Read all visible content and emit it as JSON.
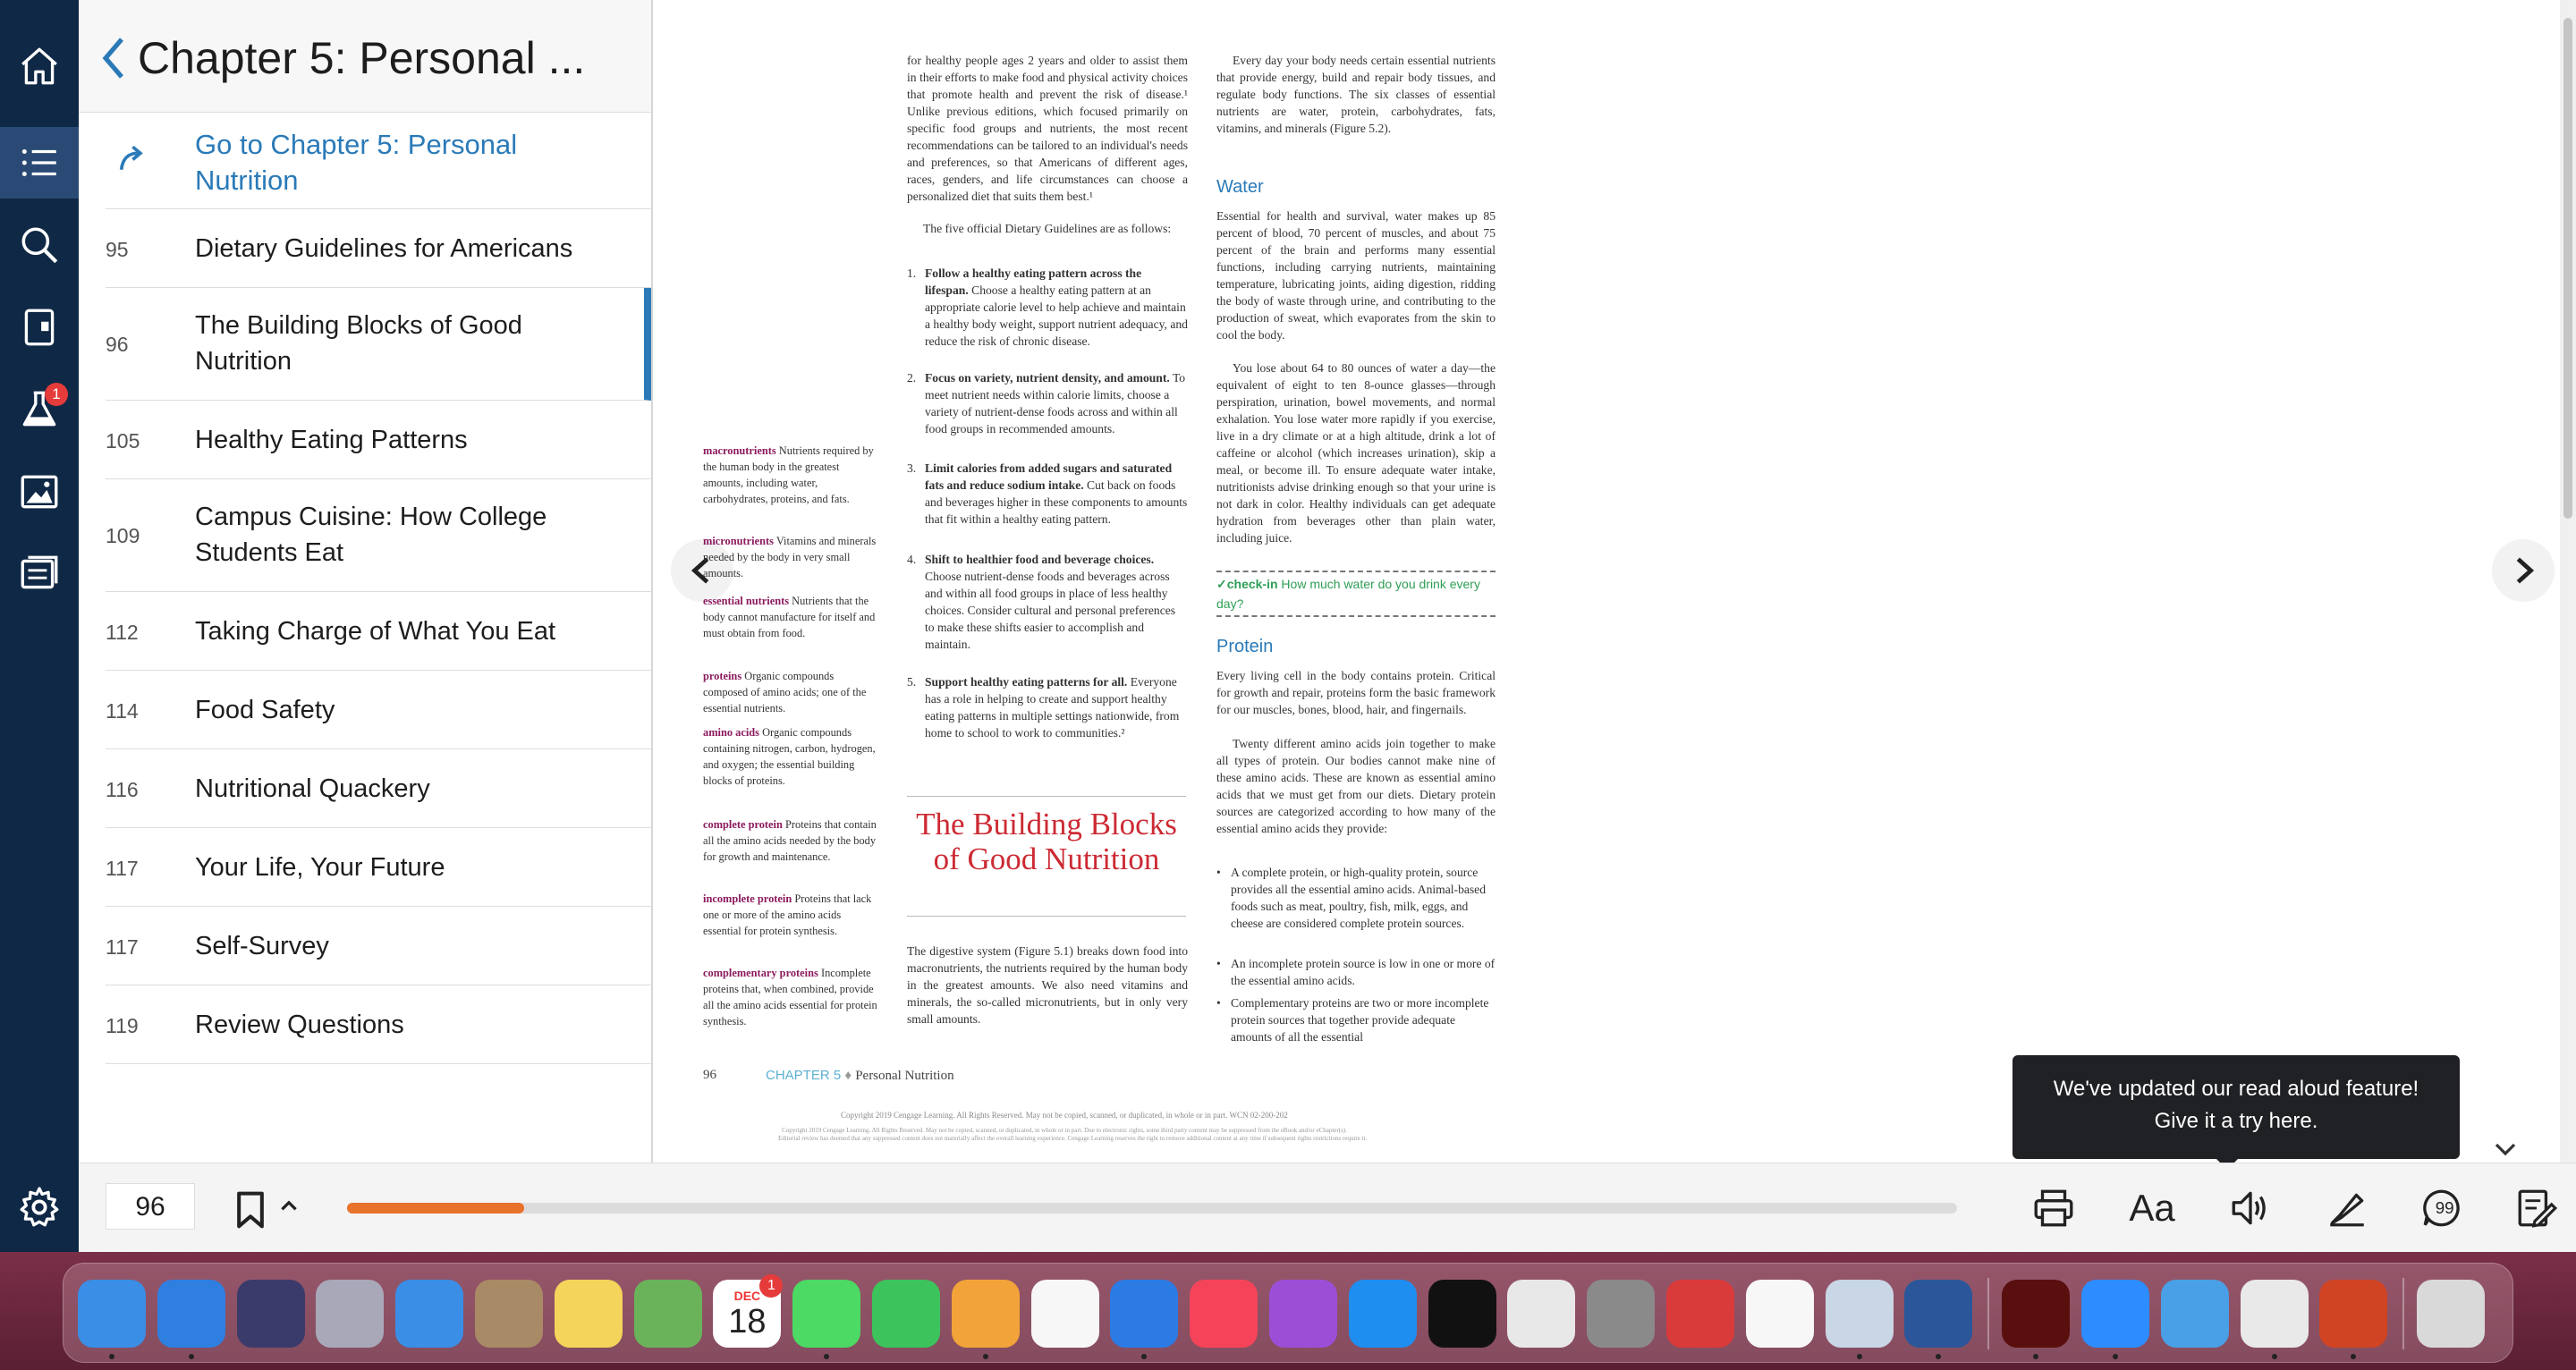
{
  "sidebar_rail": {
    "items": [
      {
        "icon": "home-icon"
      },
      {
        "icon": "table-of-contents-icon",
        "active": true
      },
      {
        "icon": "search-icon"
      },
      {
        "icon": "notebook-icon"
      },
      {
        "icon": "flask-icon",
        "badge": "1"
      },
      {
        "icon": "image-icon"
      },
      {
        "icon": "notes-icon"
      }
    ],
    "settings_icon": "gear-icon"
  },
  "toc": {
    "title": "Chapter 5: Personal ...",
    "goto_label": "Go to Chapter 5: Personal Nutrition",
    "items": [
      {
        "page": "95",
        "label": "Dietary Guidelines for Americans"
      },
      {
        "page": "96",
        "label": "The Building Blocks of Good Nutrition",
        "current": true
      },
      {
        "page": "105",
        "label": "Healthy Eating Patterns"
      },
      {
        "page": "109",
        "label": "Campus Cuisine: How College Students Eat"
      },
      {
        "page": "112",
        "label": "Taking Charge of What You Eat"
      },
      {
        "page": "114",
        "label": "Food Safety"
      },
      {
        "page": "116",
        "label": "Nutritional Quackery"
      },
      {
        "page": "117",
        "label": "Your Life, Your Future"
      },
      {
        "page": "117",
        "label": "Self-Survey"
      },
      {
        "page": "119",
        "label": "Review Questions"
      }
    ]
  },
  "book_page": {
    "glossary": [
      {
        "term": "macronutrients",
        "def": "Nutrients required by the human body in the greatest amounts, including water, carbohydrates, proteins, and fats."
      },
      {
        "term": "micronutrients",
        "def": "Vitamins and minerals needed by the body in very small amounts."
      },
      {
        "term": "essential nutrients",
        "def": "Nutrients that the body cannot manufacture for itself and must obtain from food."
      },
      {
        "term": "proteins",
        "def": "Organic compounds composed of amino acids; one of the essential nutrients."
      },
      {
        "term": "amino acids",
        "def": "Organic compounds containing nitrogen, carbon, hydrogen, and oxygen; the essential building blocks of proteins."
      },
      {
        "term": "complete protein",
        "def": "Proteins that contain all the amino acids needed by the body for growth and maintenance."
      },
      {
        "term": "incomplete protein",
        "def": "Proteins that lack one or more of the amino acids essential for protein synthesis."
      },
      {
        "term": "complementary proteins",
        "def": "Incomplete proteins that, when combined, provide all the amino acids essential for protein synthesis."
      }
    ],
    "col2_intro": "for healthy people ages 2 years and older to assist them in their efforts to make food and physical activity choices that promote health and prevent the risk of disease.¹ Unlike previous editions, which focused primarily on specific food groups and nutrients, the most recent recommendations can be tailored to an individual's needs and preferences, so that Americans of different ages, races, genders, and life circumstances can choose a personalized diet that suits them best.¹",
    "col2_intro2": "The five official Dietary Guidelines are as follows:",
    "guidelines": [
      {
        "num": "1.",
        "bold": "Follow a healthy eating pattern across the lifespan.",
        "text": " Choose a healthy eating pattern at an appropriate calorie level to help achieve and maintain a healthy body weight, support nutrient adequacy, and reduce the risk of chronic disease."
      },
      {
        "num": "2.",
        "bold": "Focus on variety, nutrient density, and amount.",
        "text": " To meet nutrient needs within calorie limits, choose a variety of nutrient-dense foods across and within all food groups in recommended amounts."
      },
      {
        "num": "3.",
        "bold": "Limit calories from added sugars and saturated fats and reduce sodium intake.",
        "text": " Cut back on foods and beverages higher in these components to amounts that fit within a healthy eating pattern."
      },
      {
        "num": "4.",
        "bold": "Shift to healthier food and beverage choices.",
        "text": " Choose nutrient-dense foods and beverages across and within all food groups in place of less healthy choices. Consider cultural and personal preferences to make these shifts easier to accomplish and maintain."
      },
      {
        "num": "5.",
        "bold": "Support healthy eating patterns for all.",
        "text": " Everyone has a role in helping to create and support healthy eating patterns in multiple settings nationwide, from home to school to work to communities.²"
      }
    ],
    "section_title": "The Building Blocks of Good Nutrition",
    "section_text": "The digestive system (Figure 5.1) breaks down food into macronutrients, the nutrients required by the human body in the greatest amounts. We also need vitamins and minerals, the so-called micronutrients, but in only very small amounts.",
    "col3_intro": "Every day your body needs certain essential nutrients that provide energy, build and repair body tissues, and regulate body functions. The six classes of essential nutrients are water, protein, carbohydrates, fats, vitamins, and minerals (Figure 5.2).",
    "water_heading": "Water",
    "water_p1": "Essential for health and survival, water makes up 85 percent of blood, 70 percent of muscles, and about 75 percent of the brain and performs many essential functions, including carrying nutrients, maintaining temperature, lubricating joints, aiding digestion, ridding the body of waste through urine, and contributing to the production of sweat, which evaporates from the skin to cool the body.",
    "water_p2": "You lose about 64 to 80 ounces of water a day—the equivalent of eight to ten 8-ounce glasses—through perspiration, urination, bowel movements, and normal exhalation. You lose water more rapidly if you exercise, live in a dry climate or at a high altitude, drink a lot of caffeine or alcohol (which increases urination), skip a meal, or become ill. To ensure adequate water intake, nutritionists advise drinking enough so that your urine is not dark in color. Healthy individuals can get adequate hydration from beverages other than plain water, including juice.",
    "checkin_label": "✓check-in",
    "checkin_text": "How much water do you drink every day?",
    "protein_heading": "Protein",
    "protein_p1": "Every living cell in the body contains protein. Critical for growth and repair, proteins form the basic framework for our muscles, bones, blood, hair, and fingernails.",
    "protein_p2": "Twenty different amino acids join together to make all types of protein. Our bodies cannot make nine of these amino acids. These are known as essential amino acids that we must get from our diets. Dietary protein sources are categorized according to how many of the essential amino acids they provide:",
    "protein_bullets": [
      "A complete protein, or high-quality protein, source provides all the essential amino acids. Animal-based foods such as meat, poultry, fish, milk, eggs, and cheese are considered complete protein sources.",
      "An incomplete protein source is low in one or more of the essential amino acids.",
      "Complementary proteins are two or more incomplete protein sources that together provide adequate amounts of all the essential"
    ],
    "footer_page": "96",
    "footer_chapter": "CHAPTER 5",
    "footer_chapter_sep": "♦",
    "footer_chapter_title": "Personal Nutrition",
    "copyright1": "Copyright 2019 Cengage Learning. All Rights Reserved. May not be copied, scanned, or duplicated, in whole or in part.  WCN 02-200-202",
    "copyright2": "Copyright 2019 Cengage Learning. All Rights Reserved. May not be copied, scanned, or duplicated, in whole or in part. Due to electronic rights, some third party content may be suppressed from the eBook and/or eChapter(s).",
    "copyright3": "Editorial review has deemed that any suppressed content does not materially affect the overall learning experience. Cengage Learning reserves the right to remove additional content at any time if subsequent rights restrictions require it."
  },
  "tooltip": {
    "line1": "We've updated our read aloud feature!",
    "line2": "Give it a try here."
  },
  "toolbar": {
    "page_value": "96",
    "progress_fraction": 0.11,
    "aa_label": "Aa",
    "icons": [
      "printer-icon",
      "font-size-icon",
      "read-aloud-speaker-icon",
      "highlighter-icon",
      "comment-icon",
      "notes-edit-icon"
    ]
  },
  "dock": {
    "calendar_month": "DEC",
    "calendar_day": "18",
    "calendar_badge": "1",
    "apps": [
      {
        "name": "finder",
        "color": "#3a8ee6"
      },
      {
        "name": "safari",
        "color": "#2f7fe0"
      },
      {
        "name": "siri",
        "color": "#3b3b6b"
      },
      {
        "name": "launchpad",
        "color": "#a8a8b8"
      },
      {
        "name": "mail",
        "color": "#3a8ee6"
      },
      {
        "name": "contacts",
        "color": "#a98a66"
      },
      {
        "name": "notes",
        "color": "#f5d45c"
      },
      {
        "name": "maps",
        "color": "#6ab35a"
      },
      {
        "name": "calendar",
        "color": "#ffffff"
      },
      {
        "name": "messages",
        "color": "#4cd964"
      },
      {
        "name": "facetime",
        "color": "#3cc35b"
      },
      {
        "name": "pages",
        "color": "#f2a33a"
      },
      {
        "name": "photos",
        "color": "#f7f7f7"
      },
      {
        "name": "keynote",
        "color": "#2c7be5"
      },
      {
        "name": "music",
        "color": "#f5445a"
      },
      {
        "name": "podcasts",
        "color": "#9b4fd6"
      },
      {
        "name": "app-store",
        "color": "#1f8ef1"
      },
      {
        "name": "apple-tv",
        "color": "#111111"
      },
      {
        "name": "script-editor",
        "color": "#e8e8e8"
      },
      {
        "name": "system-preferences",
        "color": "#8a8a8a"
      },
      {
        "name": "photo-booth",
        "color": "#d93a3a"
      },
      {
        "name": "reminders",
        "color": "#f7f7f7"
      },
      {
        "name": "preview",
        "color": "#c9d6e6"
      },
      {
        "name": "word",
        "color": "#2b579a"
      },
      {
        "name": "flash",
        "color": "#5a0f0f"
      },
      {
        "name": "zoom",
        "color": "#2d8cff"
      },
      {
        "name": "network-utility",
        "color": "#4aa0e6"
      },
      {
        "name": "chrome",
        "color": "#e9e9e9"
      },
      {
        "name": "powerpoint",
        "color": "#d04423"
      },
      {
        "name": "trash",
        "color": "#d9d9d9"
      }
    ]
  }
}
